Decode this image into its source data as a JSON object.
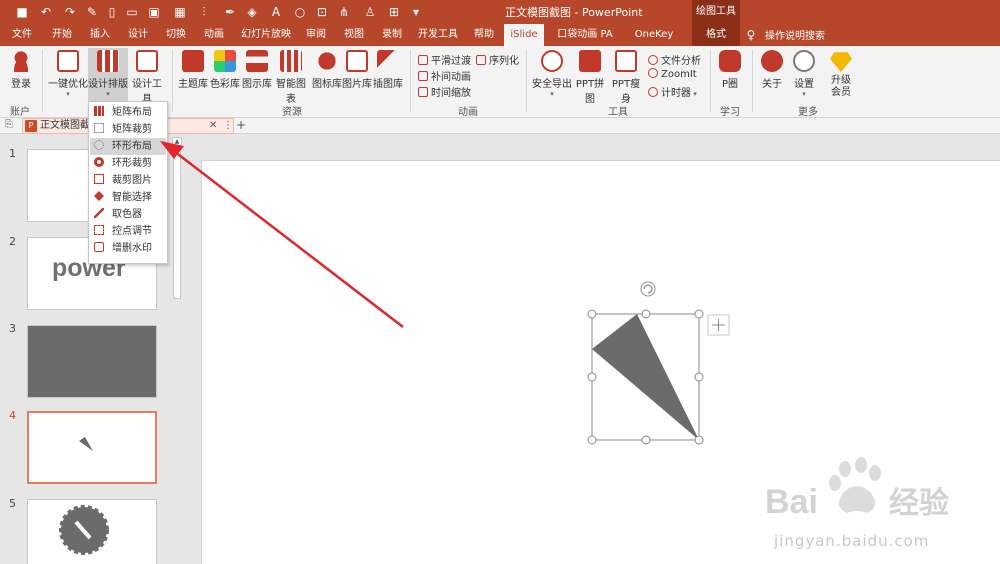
{
  "title_bar": {
    "document_title": "正文模图截图  -  PowerPoint",
    "contextual_tab": "绘图工具"
  },
  "tabs": [
    {
      "label": "文件"
    },
    {
      "label": "开始"
    },
    {
      "label": "插入"
    },
    {
      "label": "设计"
    },
    {
      "label": "切换"
    },
    {
      "label": "动画"
    },
    {
      "label": "幻灯片放映"
    },
    {
      "label": "审阅"
    },
    {
      "label": "视图"
    },
    {
      "label": "录制"
    },
    {
      "label": "开发工具"
    },
    {
      "label": "帮助"
    },
    {
      "label": "iSlide"
    },
    {
      "label": "口袋动画 PA"
    },
    {
      "label": "OneKey Lite"
    },
    {
      "label": "格式"
    }
  ],
  "tell_me": "操作说明搜索",
  "ribbon": {
    "account": {
      "login": "登录",
      "group": "账户"
    },
    "design": {
      "one_click": "一键优化",
      "layout": "设计排版",
      "tools": "设计工具"
    },
    "resources": {
      "items": [
        {
          "label": "主题库"
        },
        {
          "label": "色彩库"
        },
        {
          "label": "图示库"
        },
        {
          "label": "智能图表"
        },
        {
          "label": "图标库"
        },
        {
          "label": "图片库"
        },
        {
          "label": "插图库"
        }
      ],
      "group": "资源"
    },
    "animation": {
      "items": [
        {
          "label": "平滑过渡"
        },
        {
          "label": "补间动画"
        },
        {
          "label": "时间缩放"
        },
        {
          "label": "序列化"
        }
      ],
      "group": "动画"
    },
    "tools": {
      "security_export": "安全导出",
      "ppt_collage": "PPT拼图",
      "ppt_slim": "PPT瘦身",
      "file_analysis": "文件分析",
      "zoomit": "ZoomIt",
      "timer": "计时器",
      "group": "工具"
    },
    "learn": {
      "pcircle": "P圈",
      "group": "学习"
    },
    "more": {
      "about": "关于",
      "settings": "设置",
      "upgrade": "升级会员",
      "group": "更多"
    }
  },
  "doc_tab": {
    "label": "正文模图截图",
    "icon": "P"
  },
  "menu": {
    "items": [
      {
        "label": "矩阵布局"
      },
      {
        "label": "矩阵裁剪"
      },
      {
        "label": "环形布局"
      },
      {
        "label": "环形裁剪"
      },
      {
        "label": "裁剪图片"
      },
      {
        "label": "智能选择"
      },
      {
        "label": "取色器"
      },
      {
        "label": "控点调节"
      },
      {
        "label": "增删水印"
      }
    ],
    "highlighted_index": 2
  },
  "slides": [
    {
      "number": "1",
      "text": ""
    },
    {
      "number": "2",
      "text": "power"
    },
    {
      "number": "3",
      "text": ""
    },
    {
      "number": "4",
      "text": ""
    },
    {
      "number": "5",
      "text": ""
    }
  ],
  "watermark": {
    "brand": "Bai",
    "brand2": "经验",
    "site": "jingyan.baidu.com"
  },
  "colors": {
    "accent": "#b7472a",
    "arrow": "#e0262b",
    "shape": "#6b6b6b"
  }
}
